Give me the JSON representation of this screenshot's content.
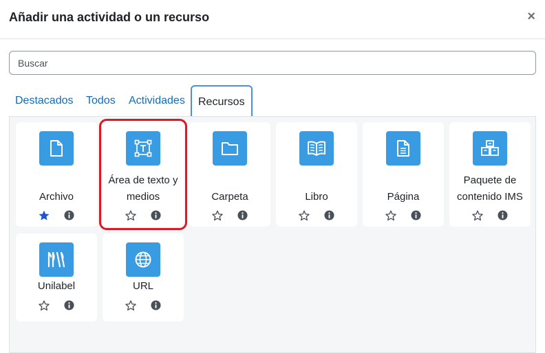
{
  "dialog": {
    "title": "Añadir una actividad o un recurso",
    "close_glyph": "×"
  },
  "search": {
    "placeholder": "Buscar",
    "value": ""
  },
  "tabs": [
    {
      "label": "Destacados",
      "active": false
    },
    {
      "label": "Todos",
      "active": false
    },
    {
      "label": "Actividades",
      "active": false
    },
    {
      "label": "Recursos",
      "active": true
    }
  ],
  "colors": {
    "accent": "#399be2",
    "link": "#0f6cbf",
    "selection": "#d81b27",
    "star_filled": "#1f56c9"
  },
  "modules": [
    {
      "label": "Archivo",
      "icon": "file-icon",
      "starred": true
    },
    {
      "label": "Área de texto y medios",
      "icon": "text-area-icon",
      "starred": false,
      "selected": true
    },
    {
      "label": "Carpeta",
      "icon": "folder-icon",
      "starred": false
    },
    {
      "label": "Libro",
      "icon": "book-icon",
      "starred": false
    },
    {
      "label": "Página",
      "icon": "page-icon",
      "starred": false
    },
    {
      "label": "Paquete de contenido IMS",
      "icon": "package-icon",
      "starred": false
    },
    {
      "label": "Unilabel",
      "icon": "unilabel-icon",
      "starred": false
    },
    {
      "label": "URL",
      "icon": "globe-icon",
      "starred": false
    }
  ]
}
